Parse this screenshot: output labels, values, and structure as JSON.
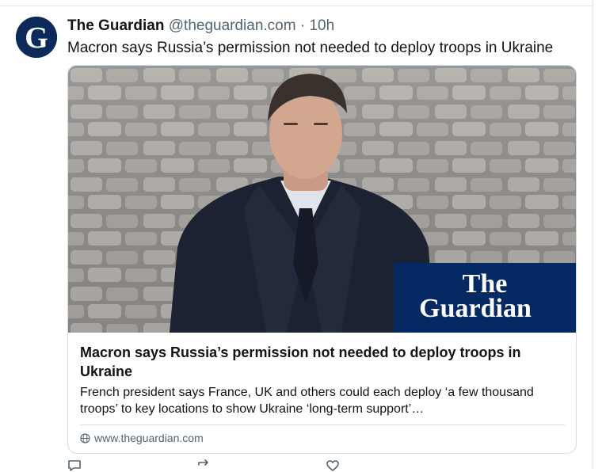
{
  "post": {
    "author": "The Guardian",
    "handle": "@theguardian.com",
    "separator": "·",
    "time": "10h",
    "text": "Macron says Russia’s permission not needed to deploy troops in Ukraine",
    "avatar_icon": "guardian-g-logo",
    "avatar_color": "#0b2a5b"
  },
  "card": {
    "image_logo_line1": "The",
    "image_logo_line2": "Guardian",
    "logo_background": "#052962",
    "title": "Macron says Russia’s permission not needed to deploy troops in Ukraine",
    "description": "French president says France, UK and others could each deploy ‘a few thousand troops’ to key locations to show Ukraine ‘long-term support’…",
    "domain": "www.theguardian.com",
    "domain_icon": "globe-icon"
  },
  "actions": {
    "reply_icon": "reply-icon",
    "repost_icon": "repost-icon",
    "like_icon": "heart-icon"
  }
}
